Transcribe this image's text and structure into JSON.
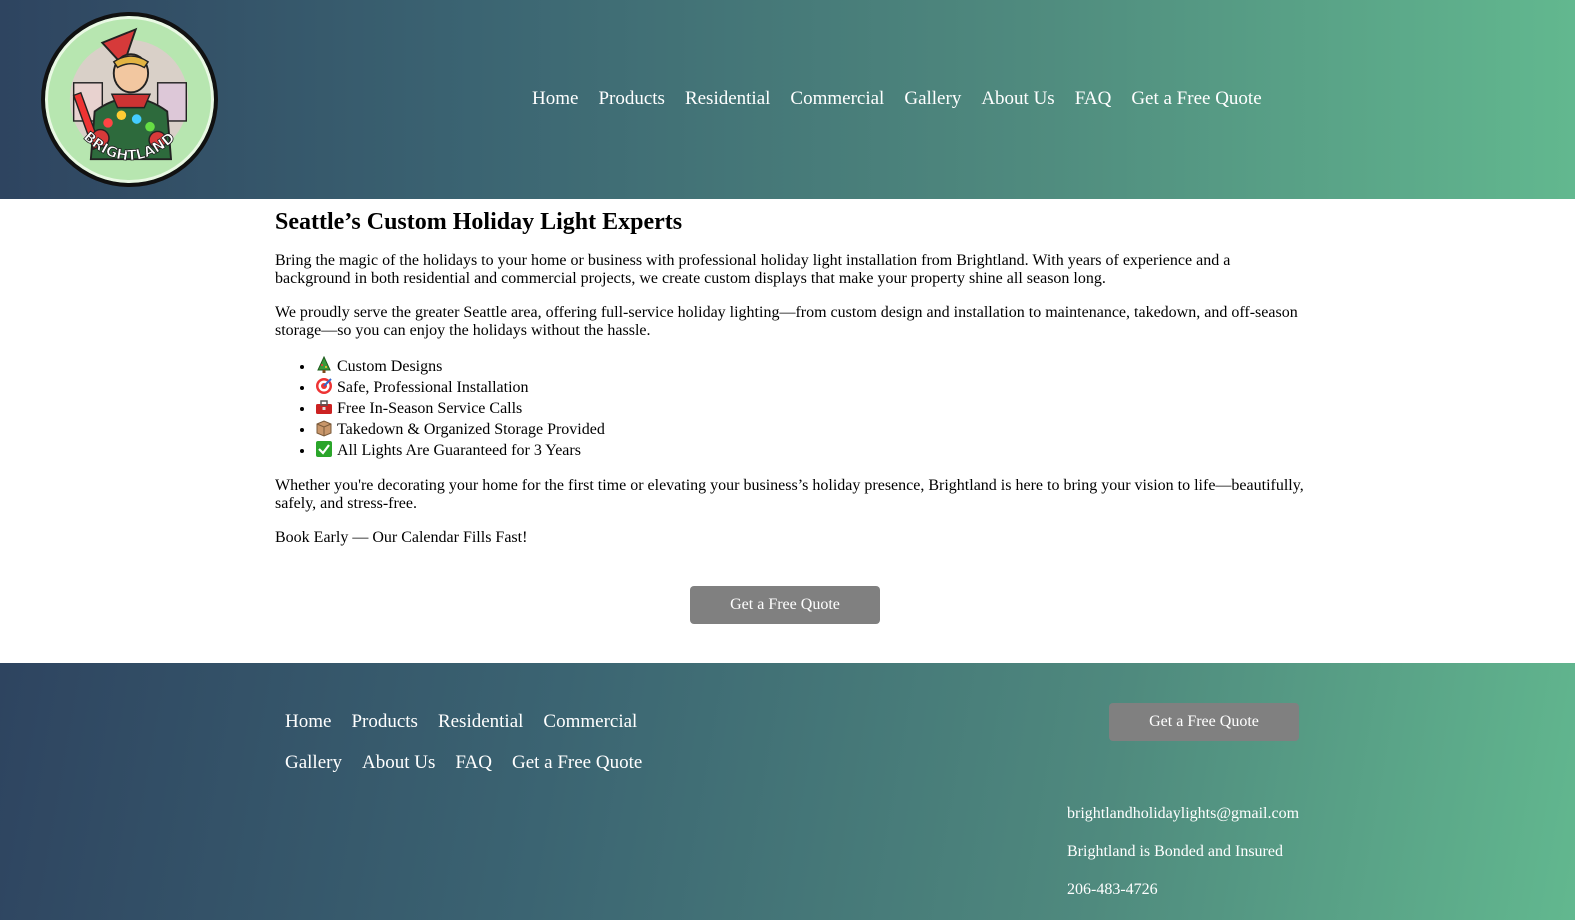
{
  "brand": {
    "logo_text": "BRIGHTLAND"
  },
  "nav": {
    "items": [
      "Home",
      "Products",
      "Residential",
      "Commercial",
      "Gallery",
      "About Us",
      "FAQ",
      "Get a Free Quote"
    ]
  },
  "main": {
    "heading": "Seattle’s Custom Holiday Light Experts",
    "para1": "Bring the magic of the holidays to your home or business with professional holiday light installation from Brightland. With years of experience and a background in both residential and commercial projects, we create custom displays that make your property shine all season long.",
    "para2": "We proudly serve the greater Seattle area, offering full-service holiday lighting—from custom design and installation to maintenance, takedown, and off-season storage—so you can enjoy the holidays without the hassle.",
    "features": [
      {
        "icon": "tree-icon",
        "label": "Custom Designs"
      },
      {
        "icon": "target-icon",
        "label": "Safe, Professional Installation"
      },
      {
        "icon": "toolbox-icon",
        "label": "Free In-Season Service Calls"
      },
      {
        "icon": "box-icon",
        "label": "Takedown & Organized Storage Provided"
      },
      {
        "icon": "check-icon",
        "label": "All Lights Are Guaranteed for 3 Years"
      }
    ],
    "para3": "Whether you're decorating your home for the first time or elevating your business’s holiday presence, Brightland is here to bring your vision to life—beautifully, safely, and stress-free.",
    "para4": "Book Early — Our Calendar Fills Fast!",
    "cta_label": "Get a Free Quote"
  },
  "footer": {
    "nav": [
      "Home",
      "Products",
      "Residential",
      "Commercial",
      "Gallery",
      "About Us",
      "FAQ",
      "Get a Free Quote"
    ],
    "cta_label": "Get a Free Quote",
    "email": "brightlandholidaylights@gmail.com",
    "insured": "Brightland is Bonded and Insured",
    "phone": "206-483-4726"
  },
  "colors": {
    "gradient_start": "#2e4460",
    "gradient_end": "#62b88f",
    "button": "#808080"
  }
}
